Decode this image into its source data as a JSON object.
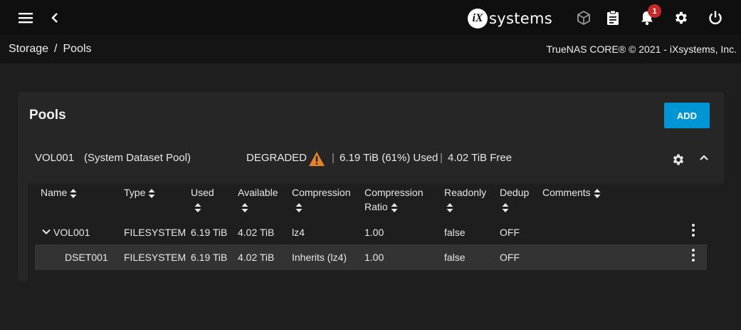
{
  "topbar": {
    "menu_icon": "hamburger-menu-icon",
    "back_icon": "chevron-left-icon",
    "logo_mark": "iX",
    "logo_text": "systems",
    "icons": [
      "truecommand-icon",
      "clipboard-icon",
      "bell-icon",
      "gear-icon",
      "power-icon"
    ],
    "notification_count": "1"
  },
  "breadcrumb": {
    "items": [
      "Storage",
      "Pools"
    ],
    "separator": "/"
  },
  "copyright": "TrueNAS CORE® © 2021 - iXsystems, Inc.",
  "card": {
    "title": "Pools",
    "add_label": "ADD",
    "add_color": "#0095d5"
  },
  "pool": {
    "name": "VOL001",
    "subtitle": "(System Dataset Pool)",
    "status": "DEGRADED",
    "status_icon": "warning-triangle-icon",
    "warning_color": "#e2832a",
    "used": "6.19 TiB (61%) Used",
    "free": "4.02 TiB Free",
    "sep": "|"
  },
  "table": {
    "columns": [
      {
        "l1": "Name",
        "l2": ""
      },
      {
        "l1": "Type",
        "l2": ""
      },
      {
        "l1": "Used",
        "l2": ""
      },
      {
        "l1": "Available",
        "l2": ""
      },
      {
        "l1": "Compression",
        "l2": ""
      },
      {
        "l1": "Compression",
        "l2": "Ratio"
      },
      {
        "l1": "Readonly",
        "l2": ""
      },
      {
        "l1": "Dedup",
        "l2": ""
      },
      {
        "l1": "Comments",
        "l2": ""
      }
    ],
    "rows": [
      {
        "name": "VOL001",
        "type": "FILESYSTEM",
        "used": "6.19 TiB",
        "available": "4.02 TiB",
        "compression": "lz4",
        "ratio": "1.00",
        "readonly": "false",
        "dedup": "OFF",
        "comments": ""
      },
      {
        "name": "DSET001",
        "type": "FILESYSTEM",
        "used": "6.19 TiB",
        "available": "4.02 TiB",
        "compression": "Inherits (lz4)",
        "ratio": "1.00",
        "readonly": "false",
        "dedup": "OFF",
        "comments": ""
      }
    ]
  }
}
